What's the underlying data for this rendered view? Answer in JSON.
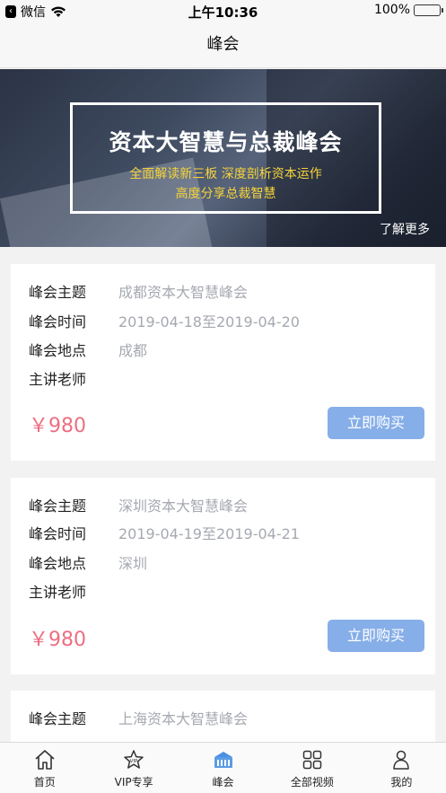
{
  "status_bar": {
    "carrier": "微信",
    "time": "上午10:36",
    "battery": "100%"
  },
  "nav": {
    "title": "峰会"
  },
  "banner": {
    "title": "资本大智慧与总裁峰会",
    "subtitle_1": "全面解读新三板 深度剖析资本运作",
    "subtitle_2": "高度分享总裁智慧",
    "more": "了解更多"
  },
  "labels": {
    "topic": "峰会主题",
    "time": "峰会时间",
    "place": "峰会地点",
    "teacher": "主讲老师"
  },
  "summits": [
    {
      "topic": "成都资本大智慧峰会",
      "time": "2019-04-18至2019-04-20",
      "place": "成都",
      "teacher": "",
      "price": "￥980",
      "buy": "立即购买"
    },
    {
      "topic": "深圳资本大智慧峰会",
      "time": "2019-04-19至2019-04-21",
      "place": "深圳",
      "teacher": "",
      "price": "￥980",
      "buy": "立即购买"
    },
    {
      "topic": "上海资本大智慧峰会"
    }
  ],
  "tabs": [
    {
      "label": "首页",
      "icon": "home-icon"
    },
    {
      "label": "VIP专享",
      "icon": "vip-star-icon"
    },
    {
      "label": "峰会",
      "icon": "summit-icon",
      "active": true
    },
    {
      "label": "全部视频",
      "icon": "grid-icon"
    },
    {
      "label": "我的",
      "icon": "user-icon"
    }
  ],
  "colors": {
    "price": "#ec6f82",
    "button": "#86aee8",
    "active_tab": "#4a90e2",
    "highlight": "#f5d33a"
  }
}
